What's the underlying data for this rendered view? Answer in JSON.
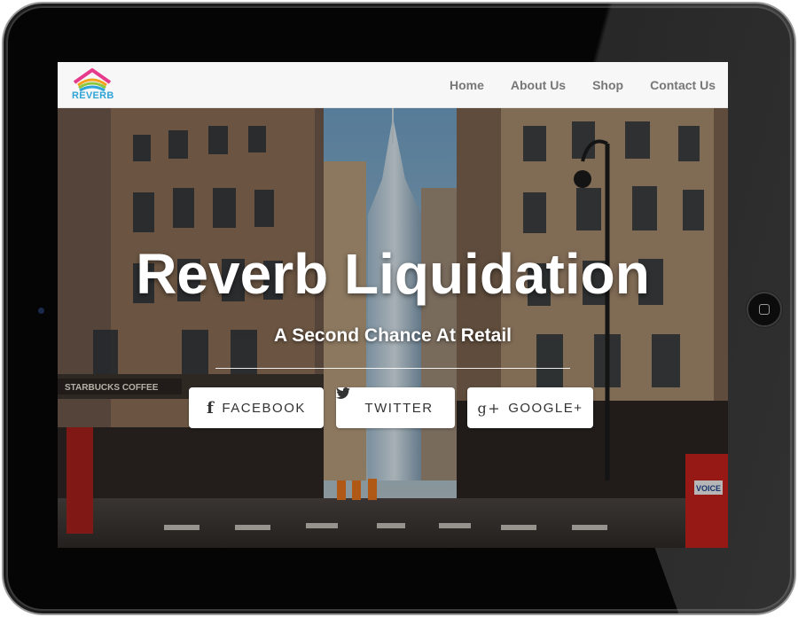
{
  "brand": {
    "logo_text": "REVERB",
    "colors": [
      "#e63b8c",
      "#f4a21d",
      "#8dc63f",
      "#2fa4d8"
    ]
  },
  "nav": {
    "items": [
      {
        "label": "Home"
      },
      {
        "label": "About Us"
      },
      {
        "label": "Shop"
      },
      {
        "label": "Contact Us"
      }
    ]
  },
  "hero": {
    "title": "Reverb Liquidation",
    "subtitle": "A Second Chance At Retail",
    "background_description_icon": "city-street-photo",
    "signs": {
      "starbucks": "STARBUCKS COFFEE",
      "voice": "VOICE"
    }
  },
  "social": {
    "buttons": [
      {
        "label": "FACEBOOK",
        "icon": "facebook-icon",
        "glyph": "f"
      },
      {
        "label": "TWITTER",
        "icon": "twitter-icon",
        "glyph": "🐦"
      },
      {
        "label": "GOOGLE+",
        "icon": "google-plus-icon",
        "glyph": "g+"
      }
    ]
  }
}
